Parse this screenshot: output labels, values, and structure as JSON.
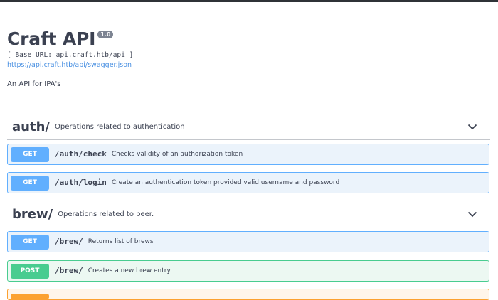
{
  "info": {
    "title": "Craft API",
    "version": "1.0",
    "base_url": "[ Base URL: api.craft.htb/api ]",
    "spec_link": "https://api.craft.htb/api/swagger.json",
    "description": "An API for IPA's"
  },
  "tags": [
    {
      "name": "auth/",
      "description": "Operations related to authentication",
      "chevron_icon": "chevron-down-icon",
      "operations": [
        {
          "method": "GET",
          "path": "/auth/check",
          "summary": "Checks validity of an authorization token",
          "color": "#61affe"
        },
        {
          "method": "GET",
          "path": "/auth/login",
          "summary": "Create an authentication token provided valid username and password",
          "color": "#61affe"
        }
      ]
    },
    {
      "name": "brew/",
      "description": "Operations related to beer.",
      "chevron_icon": "chevron-down-icon",
      "operations": [
        {
          "method": "GET",
          "path": "/brew/",
          "summary": "Returns list of brews",
          "color": "#61affe"
        },
        {
          "method": "POST",
          "path": "/brew/",
          "summary": "Creates a new brew entry",
          "color": "#49cc90"
        }
      ]
    }
  ],
  "colors": {
    "get": "#61affe",
    "post": "#49cc90",
    "put": "#fca130",
    "link": "#4990e2",
    "text": "#3b4151"
  }
}
